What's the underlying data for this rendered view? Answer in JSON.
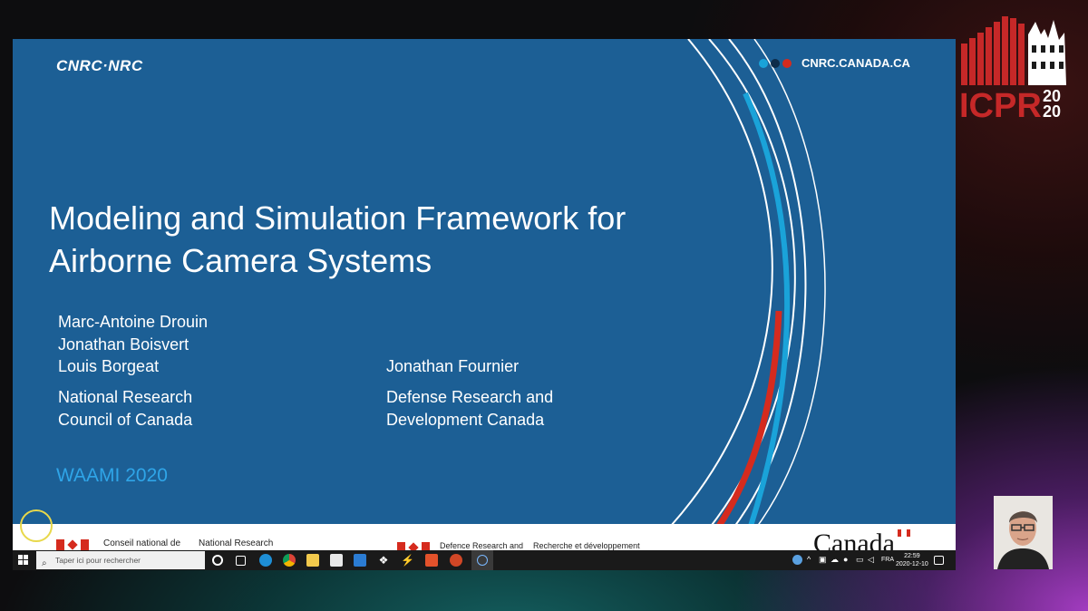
{
  "slide": {
    "org_logo": "CNRC·NRC",
    "website": "CNRC.CANADA.CA",
    "title": "Modeling and Simulation Framework for Airborne Camera Systems",
    "authors_left": [
      "Marc-Antoine Drouin",
      "Jonathan Boisvert",
      "Louis Borgeat"
    ],
    "affiliation_left": [
      "National Research",
      "Council of Canada"
    ],
    "author_right": "Jonathan Fournier",
    "affiliation_right": [
      "Defense Research and",
      "Development Canada"
    ],
    "event": "WAAMI 2020",
    "footer": {
      "nrc_fr": "Conseil national de",
      "nrc_en": "National Research",
      "drdc_en": "Defence Research and",
      "drdc_fr": "Recherche et développement",
      "wordmark": "Canada"
    },
    "colors": {
      "background": "#1c5f95",
      "accent_red": "#d52b1e",
      "event_blue": "#2fa5e8"
    }
  },
  "taskbar": {
    "search_placeholder": "Taper ici pour rechercher",
    "language": "FRA",
    "time": "22:59",
    "date": "2020-12-10",
    "icons": [
      "start-icon",
      "cortana-icon",
      "task-view-icon",
      "edge-icon",
      "chrome-icon",
      "file-explorer-icon",
      "store-icon",
      "mail-icon",
      "dropbox-icon",
      "app-icon",
      "office-icon",
      "powerpoint-icon",
      "recording-icon"
    ]
  },
  "conference_logo": {
    "name": "ICPR",
    "year_top": "20",
    "year_bottom": "20"
  }
}
